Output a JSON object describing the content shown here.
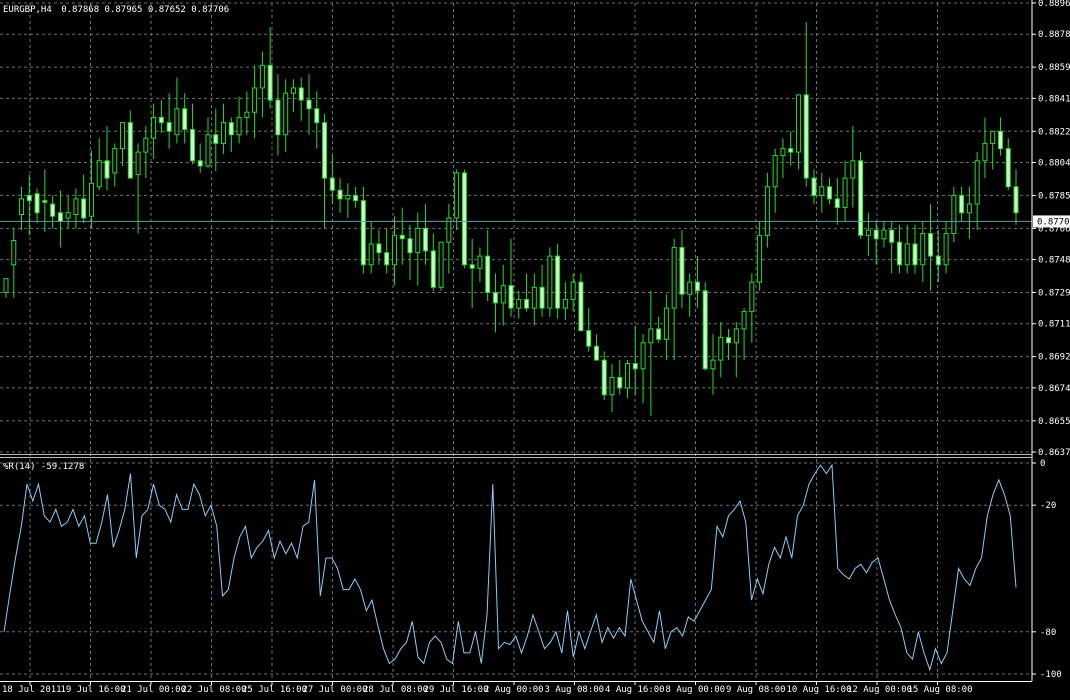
{
  "header": {
    "symbol": "EURGBP,H4",
    "ohlc": "0.87868 0.87965 0.87652 0.87706"
  },
  "current_price": "0.8770",
  "indicator": {
    "label": "%R(14) -59.1278"
  },
  "colors": {
    "background": "#000000",
    "grid": "#6e6e6e",
    "bull_body": "#000000",
    "bear_body": "#ccffcc",
    "wick": "#22dd22",
    "price_line": "#5f9ea0",
    "wpr_line": "#87cefa",
    "axis_text": "#ffffff"
  },
  "chart_data": [
    {
      "type": "candlestick",
      "title": "EURGBP,H4",
      "y_ticks": [
        "0.8896",
        "0.8878",
        "0.8859",
        "0.8841",
        "0.8822",
        "0.8804",
        "0.8785",
        "0.8766",
        "0.8748",
        "0.8729",
        "0.8711",
        "0.8692",
        "0.8674",
        "0.8655",
        "0.8637"
      ],
      "ylim": [
        0.8637,
        0.8896
      ],
      "x_ticks": [
        "18 Jul 2011",
        "19 Jul 16:00",
        "21 Jul 00:00",
        "22 Jul 08:00",
        "25 Jul 16:00",
        "27 Jul 00:00",
        "28 Jul 08:00",
        "29 Jul 16:00",
        "2 Aug 00:00",
        "3 Aug 08:00",
        "4 Aug 16:00",
        "8 Aug 00:00",
        "9 Aug 08:00",
        "10 Aug 16:00",
        "12 Aug 00:00",
        "15 Aug 08:00"
      ],
      "current_price": 0.877,
      "grid": true,
      "series": [
        {
          "ohlc": [
            [
              0.8729,
              0.8737,
              0.8726,
              0.8737
            ],
            [
              0.8745,
              0.8766,
              0.8726,
              0.8759
            ],
            [
              0.8774,
              0.879,
              0.8765,
              0.8783
            ],
            [
              0.8785,
              0.8797,
              0.8762,
              0.8782
            ],
            [
              0.8786,
              0.8789,
              0.8769,
              0.8775
            ],
            [
              0.8782,
              0.88,
              0.8764,
              0.8781
            ],
            [
              0.878,
              0.8785,
              0.8766,
              0.8773
            ],
            [
              0.8775,
              0.8788,
              0.8755,
              0.877
            ],
            [
              0.8772,
              0.8785,
              0.8766,
              0.8775
            ],
            [
              0.8774,
              0.8789,
              0.8766,
              0.8783
            ],
            [
              0.8783,
              0.8797,
              0.8769,
              0.8772
            ],
            [
              0.8773,
              0.8811,
              0.8766,
              0.8792
            ],
            [
              0.879,
              0.8818,
              0.8788,
              0.8805
            ],
            [
              0.8805,
              0.8825,
              0.8788,
              0.8795
            ],
            [
              0.8798,
              0.8815,
              0.879,
              0.8812
            ],
            [
              0.8812,
              0.8827,
              0.8802,
              0.8827
            ],
            [
              0.8827,
              0.8834,
              0.8805,
              0.8795
            ],
            [
              0.8797,
              0.8815,
              0.8763,
              0.881
            ],
            [
              0.881,
              0.8825,
              0.8795,
              0.8818
            ],
            [
              0.8818,
              0.8838,
              0.8806,
              0.883
            ],
            [
              0.883,
              0.884,
              0.8821,
              0.8827
            ],
            [
              0.8827,
              0.8844,
              0.8812,
              0.8822
            ],
            [
              0.882,
              0.8853,
              0.8815,
              0.8835
            ],
            [
              0.8835,
              0.8844,
              0.8815,
              0.8823
            ],
            [
              0.8823,
              0.8838,
              0.8803,
              0.8805
            ],
            [
              0.8805,
              0.8815,
              0.8798,
              0.8802
            ],
            [
              0.8802,
              0.883,
              0.8801,
              0.882
            ],
            [
              0.882,
              0.8835,
              0.8799,
              0.8815
            ],
            [
              0.8815,
              0.8838,
              0.8809,
              0.8827
            ],
            [
              0.8827,
              0.883,
              0.881,
              0.882
            ],
            [
              0.882,
              0.8842,
              0.8815,
              0.883
            ],
            [
              0.883,
              0.8845,
              0.882,
              0.8833
            ],
            [
              0.8833,
              0.886,
              0.8818,
              0.8847
            ],
            [
              0.8847,
              0.8868,
              0.883,
              0.886
            ],
            [
              0.886,
              0.8882,
              0.8835,
              0.884
            ],
            [
              0.884,
              0.8855,
              0.8808,
              0.882
            ],
            [
              0.882,
              0.8852,
              0.881,
              0.8844
            ],
            [
              0.8844,
              0.8852,
              0.8833,
              0.8847
            ],
            [
              0.8847,
              0.8853,
              0.8828,
              0.884
            ],
            [
              0.884,
              0.8855,
              0.882,
              0.8835
            ],
            [
              0.8835,
              0.8845,
              0.8812,
              0.8827
            ],
            [
              0.8827,
              0.8832,
              0.8766,
              0.8795
            ],
            [
              0.8795,
              0.8808,
              0.878,
              0.8788
            ],
            [
              0.8788,
              0.8795,
              0.8775,
              0.8783
            ],
            [
              0.8783,
              0.8792,
              0.8772,
              0.8785
            ],
            [
              0.8785,
              0.879,
              0.8778,
              0.8782
            ],
            [
              0.8782,
              0.879,
              0.874,
              0.8745
            ],
            [
              0.8745,
              0.877,
              0.874,
              0.8757
            ],
            [
              0.8757,
              0.8765,
              0.8745,
              0.8752
            ],
            [
              0.8752,
              0.8766,
              0.874,
              0.8745
            ],
            [
              0.8745,
              0.8773,
              0.8733,
              0.8762
            ],
            [
              0.8762,
              0.8778,
              0.8745,
              0.876
            ],
            [
              0.876,
              0.8768,
              0.8736,
              0.8752
            ],
            [
              0.8752,
              0.8775,
              0.8733,
              0.8766
            ],
            [
              0.8766,
              0.878,
              0.8745,
              0.8753
            ],
            [
              0.8753,
              0.8763,
              0.873,
              0.8732
            ],
            [
              0.8732,
              0.8758,
              0.873,
              0.8758
            ],
            [
              0.8758,
              0.878,
              0.874,
              0.8772
            ],
            [
              0.8772,
              0.88,
              0.8765,
              0.8798
            ],
            [
              0.8798,
              0.88,
              0.8743,
              0.8745
            ],
            [
              0.8745,
              0.876,
              0.872,
              0.8743
            ],
            [
              0.8743,
              0.8755,
              0.8735,
              0.875
            ],
            [
              0.875,
              0.8765,
              0.8724,
              0.8729
            ],
            [
              0.8729,
              0.874,
              0.8706,
              0.8723
            ],
            [
              0.8723,
              0.8745,
              0.871,
              0.8733
            ],
            [
              0.8733,
              0.876,
              0.8715,
              0.872
            ],
            [
              0.872,
              0.873,
              0.8714,
              0.8725
            ],
            [
              0.8725,
              0.874,
              0.8718,
              0.872
            ],
            [
              0.872,
              0.874,
              0.871,
              0.8732
            ],
            [
              0.8732,
              0.8745,
              0.8715,
              0.872
            ],
            [
              0.872,
              0.8755,
              0.8715,
              0.875
            ],
            [
              0.875,
              0.8757,
              0.8714,
              0.872
            ],
            [
              0.872,
              0.8735,
              0.8713,
              0.8725
            ],
            [
              0.8725,
              0.874,
              0.8718,
              0.8735
            ],
            [
              0.8735,
              0.874,
              0.871,
              0.8707
            ],
            [
              0.8707,
              0.872,
              0.8695,
              0.8698
            ],
            [
              0.8698,
              0.8705,
              0.869,
              0.869
            ],
            [
              0.869,
              0.8695,
              0.8667,
              0.867
            ],
            [
              0.867,
              0.8688,
              0.866,
              0.868
            ],
            [
              0.868,
              0.869,
              0.867,
              0.8674
            ],
            [
              0.8674,
              0.869,
              0.8668,
              0.8688
            ],
            [
              0.8688,
              0.871,
              0.867,
              0.8685
            ],
            [
              0.8685,
              0.8705,
              0.8665,
              0.87
            ],
            [
              0.87,
              0.873,
              0.8658,
              0.8708
            ],
            [
              0.8708,
              0.8715,
              0.87,
              0.8702
            ],
            [
              0.8702,
              0.8728,
              0.869,
              0.872
            ],
            [
              0.872,
              0.876,
              0.869,
              0.8755
            ],
            [
              0.8755,
              0.8765,
              0.872,
              0.8728
            ],
            [
              0.8728,
              0.874,
              0.8715,
              0.8735
            ],
            [
              0.8735,
              0.875,
              0.872,
              0.873
            ],
            [
              0.873,
              0.8735,
              0.8684,
              0.8685
            ],
            [
              0.8685,
              0.8705,
              0.867,
              0.869
            ],
            [
              0.869,
              0.8712,
              0.868,
              0.8703
            ],
            [
              0.8703,
              0.8708,
              0.869,
              0.87
            ],
            [
              0.87,
              0.8712,
              0.868,
              0.8708
            ],
            [
              0.8708,
              0.872,
              0.869,
              0.8718
            ],
            [
              0.8718,
              0.874,
              0.87,
              0.8735
            ],
            [
              0.8735,
              0.877,
              0.873,
              0.8762
            ],
            [
              0.8762,
              0.8798,
              0.8755,
              0.879
            ],
            [
              0.879,
              0.8812,
              0.8775,
              0.8808
            ],
            [
              0.8808,
              0.8818,
              0.8795,
              0.8812
            ],
            [
              0.8812,
              0.8822,
              0.8802,
              0.881
            ],
            [
              0.881,
              0.8833,
              0.88,
              0.8843
            ],
            [
              0.8843,
              0.8885,
              0.879,
              0.8795
            ],
            [
              0.8795,
              0.88,
              0.878,
              0.8785
            ],
            [
              0.8785,
              0.8798,
              0.8775,
              0.879
            ],
            [
              0.879,
              0.8795,
              0.878,
              0.8783
            ],
            [
              0.8783,
              0.8795,
              0.8768,
              0.8778
            ],
            [
              0.8778,
              0.8805,
              0.877,
              0.8795
            ],
            [
              0.8795,
              0.8825,
              0.8778,
              0.8805
            ],
            [
              0.8805,
              0.881,
              0.876,
              0.8762
            ],
            [
              0.8762,
              0.8775,
              0.875,
              0.8765
            ],
            [
              0.8765,
              0.877,
              0.8745,
              0.876
            ],
            [
              0.876,
              0.877,
              0.8755,
              0.8765
            ],
            [
              0.8765,
              0.877,
              0.874,
              0.8758
            ],
            [
              0.8758,
              0.8768,
              0.874,
              0.8745
            ],
            [
              0.8745,
              0.8768,
              0.874,
              0.8757
            ],
            [
              0.8757,
              0.8768,
              0.874,
              0.8745
            ],
            [
              0.8745,
              0.877,
              0.8735,
              0.8763
            ],
            [
              0.8763,
              0.878,
              0.873,
              0.875
            ],
            [
              0.875,
              0.8765,
              0.8735,
              0.8745
            ],
            [
              0.8745,
              0.877,
              0.874,
              0.8763
            ],
            [
              0.8763,
              0.879,
              0.8758,
              0.8785
            ],
            [
              0.8785,
              0.879,
              0.877,
              0.8775
            ],
            [
              0.8775,
              0.879,
              0.876,
              0.878
            ],
            [
              0.878,
              0.881,
              0.8765,
              0.8805
            ],
            [
              0.8805,
              0.883,
              0.8795,
              0.8815
            ],
            [
              0.8815,
              0.8822,
              0.88,
              0.8822
            ],
            [
              0.8822,
              0.883,
              0.8808,
              0.8812
            ],
            [
              0.8812,
              0.8818,
              0.8788,
              0.879
            ],
            [
              0.879,
              0.88,
              0.8768,
              0.8775
            ]
          ]
        }
      ]
    },
    {
      "type": "line",
      "title": "%R(14) -59.1278",
      "y_ticks": [
        "0",
        "-20",
        "-80",
        "-100"
      ],
      "ylim": [
        -100,
        0
      ],
      "series": [
        {
          "values": [
            -80,
            -62,
            -45,
            -30,
            -10,
            -18,
            -10,
            -25,
            -28,
            -22,
            -30,
            -28,
            -22,
            -30,
            -25,
            -38,
            -38,
            -28,
            -15,
            -40,
            -32,
            -22,
            -5,
            -45,
            -25,
            -22,
            -10,
            -20,
            -22,
            -28,
            -15,
            -22,
            -22,
            -10,
            -15,
            -25,
            -20,
            -30,
            -63,
            -60,
            -45,
            -35,
            -30,
            -45,
            -40,
            -37,
            -32,
            -45,
            -37,
            -43,
            -38,
            -45,
            -30,
            -28,
            -8,
            -63,
            -45,
            -45,
            -50,
            -60,
            -60,
            -55,
            -60,
            -70,
            -65,
            -77,
            -88,
            -95,
            -93,
            -88,
            -85,
            -75,
            -92,
            -95,
            -85,
            -82,
            -85,
            -93,
            -95,
            -75,
            -90,
            -90,
            -80,
            -95,
            -72,
            -10,
            -88,
            -85,
            -86,
            -82,
            -90,
            -82,
            -72,
            -80,
            -88,
            -85,
            -80,
            -90,
            -70,
            -92,
            -80,
            -88,
            -80,
            -72,
            -85,
            -78,
            -83,
            -78,
            -82,
            -55,
            -65,
            -75,
            -80,
            -85,
            -70,
            -88,
            -80,
            -78,
            -82,
            -73,
            -75,
            -70,
            -65,
            -60,
            -30,
            -35,
            -25,
            -22,
            -18,
            -28,
            -65,
            -55,
            -62,
            -48,
            -40,
            -45,
            -35,
            -45,
            -25,
            -20,
            -10,
            -5,
            -1,
            -5,
            -1,
            -50,
            -53,
            -55,
            -50,
            -48,
            -52,
            -47,
            -45,
            -55,
            -65,
            -72,
            -78,
            -90,
            -93,
            -80,
            -90,
            -98,
            -88,
            -95,
            -90,
            -70,
            -50,
            -55,
            -58,
            -50,
            -45,
            -25,
            -15,
            -8,
            -15,
            -25,
            -59
          ]
        }
      ]
    }
  ]
}
